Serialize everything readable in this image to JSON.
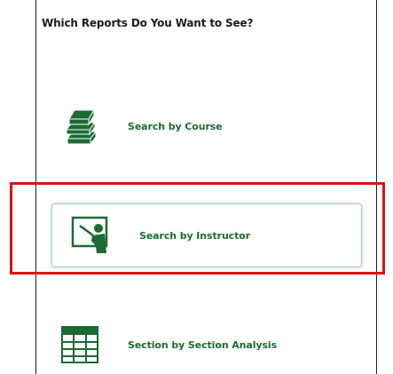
{
  "heading": "Which Reports Do You Want to See?",
  "options": [
    {
      "label": "Search by Course",
      "icon": "books-icon"
    },
    {
      "label": "Search by Instructor",
      "icon": "instructor-board-icon"
    },
    {
      "label": "Section by Section Analysis",
      "icon": "table-grid-icon"
    }
  ],
  "colors": {
    "accent": "#1b6b33",
    "highlight": "#e01010"
  }
}
